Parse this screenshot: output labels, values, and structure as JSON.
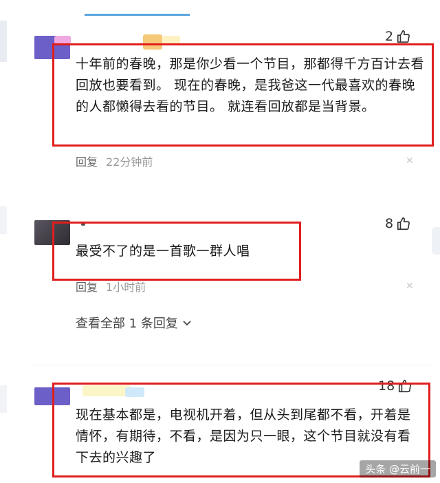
{
  "comments": [
    {
      "likes": "2",
      "text": "十年前的春晚，那是你少看一个节目，那都得千方百计去看回放也要看到。 现在的春晚，是我爸这一代最喜欢的春晚的人都懒得去看的节目。 就连看回放都是当背景。",
      "reply_label": "回复",
      "time": "22分钟前"
    },
    {
      "likes": "8",
      "text": "最受不了的是一首歌一群人唱",
      "reply_label": "回复",
      "time": "1小时前",
      "view_replies": "查看全部 1 条回复"
    },
    {
      "likes": "18",
      "text": "现在基本都是，电视机开着，但从头到尾都不看，开着是情怀，有期待，不看，是因为只一眼，这个节目就没有看下去的兴趣了"
    }
  ],
  "icons": {
    "like": "thumbs-up-icon",
    "close": "close-icon",
    "chevron": "chevron-down-icon"
  },
  "colors": {
    "highlight_box": "#e11d1d",
    "avatar_purple": "#6c5fc7"
  },
  "watermark": "头条 @云前一"
}
